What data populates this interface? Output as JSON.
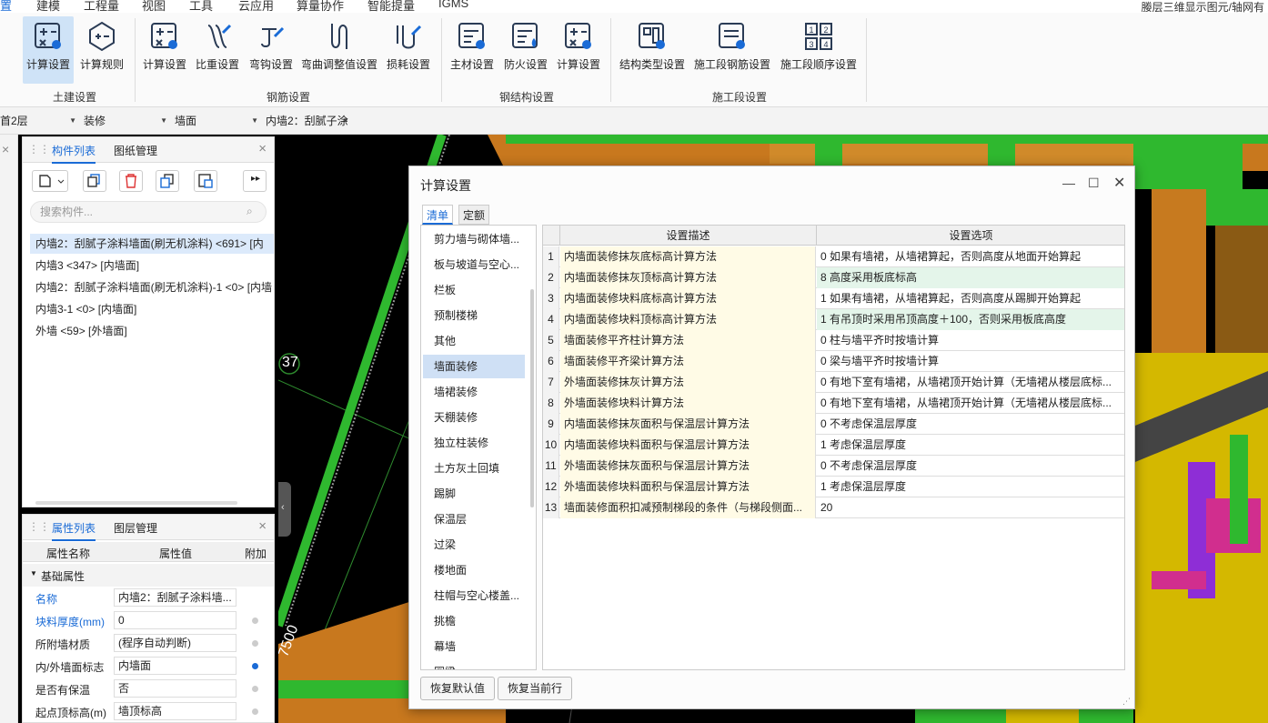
{
  "menu": {
    "items": [
      "置",
      "建模",
      "工程量",
      "视图",
      "工具",
      "云应用",
      "算量协作",
      "智能提量",
      "IGMS"
    ],
    "top_right": "媵层三维显示图元/轴网有"
  },
  "ribbon": {
    "tujian": {
      "group": "土建设置",
      "buttons": [
        "计算设置",
        "计算规则"
      ]
    },
    "gangjin": {
      "group": "钢筋设置",
      "buttons": [
        "计算设置",
        "比重设置",
        "弯钩设置",
        "弯曲调整值设置",
        "损耗设置"
      ]
    },
    "gangjiegou": {
      "group": "钢结构设置",
      "buttons": [
        "主材设置",
        "防火设置",
        "计算设置"
      ]
    },
    "shigongduan": {
      "group": "施工段设置",
      "buttons": [
        "结构类型设置",
        "施工段钢筋设置",
        "施工段顺序设置"
      ]
    }
  },
  "filters": {
    "floor": "首2层",
    "category": "装修",
    "type": "墙面",
    "element": "内墙2：刮腻子涂"
  },
  "component_panel": {
    "tabs": [
      "构件列表",
      "图纸管理"
    ],
    "search_placeholder": "搜索构件...",
    "items": [
      "内墙2：刮腻子涂料墙面(刷无机涂料) <691> [内",
      "内墙3 <347> [内墙面]",
      "内墙2：刮腻子涂料墙面(刷无机涂料)-1 <0> [内墙",
      "内墙3-1 <0> [内墙面]",
      "外墙 <59> [外墙面]"
    ]
  },
  "property_panel": {
    "tabs": [
      "属性列表",
      "图层管理"
    ],
    "headers": [
      "属性名称",
      "属性值",
      "附加"
    ],
    "section": "基础属性",
    "rows": [
      {
        "name": "名称",
        "value": "内墙2：刮腻子涂料墙..."
      },
      {
        "name": "块料厚度(mm)",
        "value": "0"
      },
      {
        "name": "所附墙材质",
        "value": "(程序自动判断)"
      },
      {
        "name": "内/外墙面标志",
        "value": "内墙面"
      },
      {
        "name": "是否有保温",
        "value": "否"
      },
      {
        "name": "起点顶标高(m)",
        "value": "墙顶标高"
      }
    ]
  },
  "viewport": {
    "axis_label": "37",
    "dim_label": "7500"
  },
  "dialog": {
    "title": "计算设置",
    "tabs": [
      "清单",
      "定额"
    ],
    "categories": [
      "剪力墙与砌体墙...",
      "板与坡道与空心...",
      "栏板",
      "预制楼梯",
      "其他",
      "墙面装修",
      "墙裙装修",
      "天棚装修",
      "独立柱装修",
      "土方灰土回填",
      "踢脚",
      "保温层",
      "过梁",
      "楼地面",
      "柱帽与空心楼盖...",
      "挑檐",
      "幕墙",
      "圈梁"
    ],
    "selected_category": "墙面装修",
    "columns": [
      "设置描述",
      "设置选项"
    ],
    "rows": [
      {
        "no": "1",
        "desc": "内墙面装修抹灰底标高计算方法",
        "opt": "0 如果有墙裙，从墙裙算起，否则高度从地面开始算起"
      },
      {
        "no": "2",
        "desc": "内墙面装修抹灰顶标高计算方法",
        "opt": "8 高度采用板底标高"
      },
      {
        "no": "3",
        "desc": "内墙面装修块料底标高计算方法",
        "opt": "1 如果有墙裙，从墙裙算起，否则高度从踢脚开始算起"
      },
      {
        "no": "4",
        "desc": "内墙面装修块料顶标高计算方法",
        "opt": "1 有吊顶时采用吊顶高度＋100，否则采用板底高度"
      },
      {
        "no": "5",
        "desc": "墙面装修平齐柱计算方法",
        "opt": "0 柱与墙平齐时按墙计算"
      },
      {
        "no": "6",
        "desc": "墙面装修平齐梁计算方法",
        "opt": "0 梁与墙平齐时按墙计算"
      },
      {
        "no": "7",
        "desc": "外墙面装修抹灰计算方法",
        "opt": "0 有地下室有墙裙，从墙裙顶开始计算（无墙裙从楼层底标..."
      },
      {
        "no": "8",
        "desc": "外墙面装修块料计算方法",
        "opt": "0 有地下室有墙裙，从墙裙顶开始计算（无墙裙从楼层底标..."
      },
      {
        "no": "9",
        "desc": "内墙面装修抹灰面积与保温层计算方法",
        "opt": "0 不考虑保温层厚度"
      },
      {
        "no": "10",
        "desc": "内墙面装修块料面积与保温层计算方法",
        "opt": "1 考虑保温层厚度"
      },
      {
        "no": "11",
        "desc": "外墙面装修抹灰面积与保温层计算方法",
        "opt": "0 不考虑保温层厚度"
      },
      {
        "no": "12",
        "desc": "外墙面装修块料面积与保温层计算方法",
        "opt": "1 考虑保温层厚度"
      },
      {
        "no": "13",
        "desc": "墙面装修面积扣减预制梯段的条件（与梯段侧面...",
        "opt": "20"
      }
    ],
    "buttons": {
      "restore_default": "恢复默认值",
      "restore_row": "恢复当前行"
    }
  },
  "colors": {
    "accent": "#1a6bd6",
    "active_button": "#cfe3f7",
    "desc_bg": "#fffbe6",
    "highlight_row": "#e4f5ea"
  }
}
